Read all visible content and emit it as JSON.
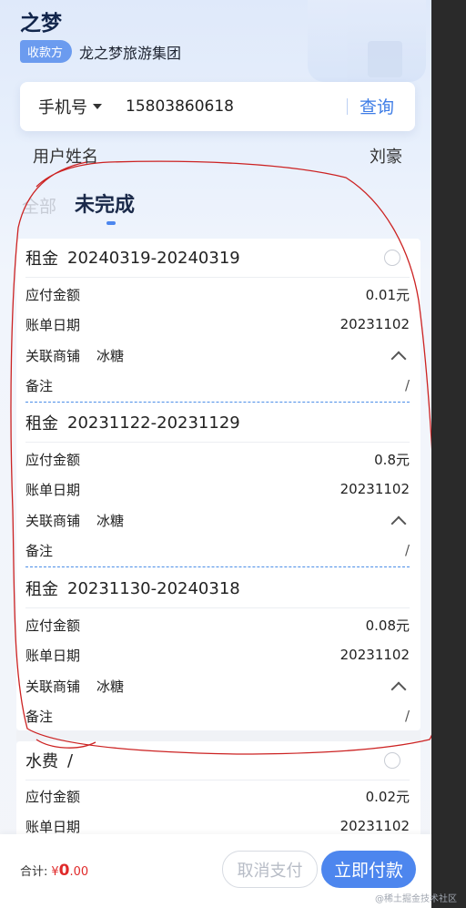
{
  "header": {
    "brand_title": "之梦",
    "payee_badge": "收款方",
    "payee_name": "龙之梦旅游集团"
  },
  "search": {
    "select_label": "手机号",
    "phone_value": "15803860618",
    "query_label": "查询"
  },
  "user": {
    "label": "用户姓名",
    "name": "刘豪"
  },
  "tabs": {
    "all": "全部",
    "active": "未完成"
  },
  "field_labels": {
    "amount": "应付金额",
    "bill_date": "账单日期",
    "shop": "关联商铺",
    "note": "备注"
  },
  "bills": [
    {
      "type": "租金",
      "period": "20240319-20240319",
      "amount": "0.01元",
      "bill_date": "20231102",
      "shop": "冰糖",
      "note": "/"
    },
    {
      "type": "租金",
      "period": "20231122-20231129",
      "amount": "0.8元",
      "bill_date": "20231102",
      "shop": "冰糖",
      "note": "/"
    },
    {
      "type": "租金",
      "period": "20231130-20240318",
      "amount": "0.08元",
      "bill_date": "20231102",
      "shop": "冰糖",
      "note": "/"
    },
    {
      "type": "水费",
      "period": "/",
      "amount": "0.02元",
      "bill_date": "20231102"
    }
  ],
  "footer": {
    "total_label": "合计:",
    "currency": "¥",
    "total_int": "0",
    "total_dec": ".00",
    "cancel_label": "取消支付",
    "pay_label": "立即付款"
  },
  "watermark": "@稀土掘金技术社区",
  "colors": {
    "accent": "#4d86ee",
    "price": "#e02a2a",
    "annotation": "#cc2222"
  },
  "icons": {
    "dropdown": "caret-down-icon",
    "collapse": "chevron-up-icon",
    "select": "radio-circle-icon"
  }
}
